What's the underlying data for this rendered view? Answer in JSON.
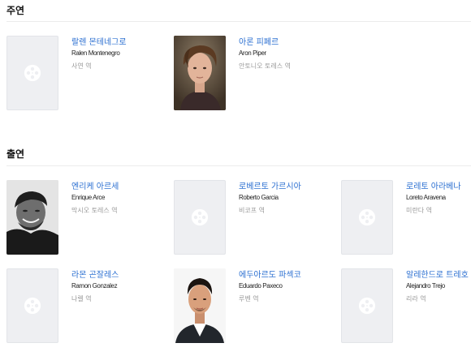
{
  "sections": {
    "main_cast": {
      "title": "주연",
      "members": [
        {
          "name_ko": "랄렌 몬테네그로",
          "name_en": "Ralen Montenegro",
          "role": "사연 역",
          "photo": "placeholder-film-icon"
        },
        {
          "name_ko": "아론 피페르",
          "name_en": "Aron Piper",
          "role": "안토니오 토레스 역",
          "photo": "photo"
        }
      ]
    },
    "supporting_cast": {
      "title": "출연",
      "members": [
        {
          "name_ko": "엔리케 아르세",
          "name_en": "Enrique Arce",
          "role": "막시오 토레스 역",
          "photo": "photo"
        },
        {
          "name_ko": "로베르토 가르시아",
          "name_en": "Roberto Garcia",
          "role": "비코프 역",
          "photo": "placeholder-film-icon"
        },
        {
          "name_ko": "로레토 아라베나",
          "name_en": "Loreto Aravena",
          "role": "미란다 역",
          "photo": "placeholder-film-icon"
        },
        {
          "name_ko": "라몬 곤잘레스",
          "name_en": "Ramon Gonzalez",
          "role": "나렐 역",
          "photo": "placeholder-film-icon"
        },
        {
          "name_ko": "에두아르도 파섹코",
          "name_en": "Eduardo Paxeco",
          "role": "루벤 역",
          "photo": "photo"
        },
        {
          "name_ko": "알레한드로 트레호",
          "name_en": "Alejandro Trejo",
          "role": "리라 역",
          "photo": "placeholder-film-icon"
        }
      ]
    }
  },
  "colors": {
    "link": "#2b6fd1",
    "role_text": "#9a9a9a",
    "placeholder_bg": "#eeeff2"
  }
}
